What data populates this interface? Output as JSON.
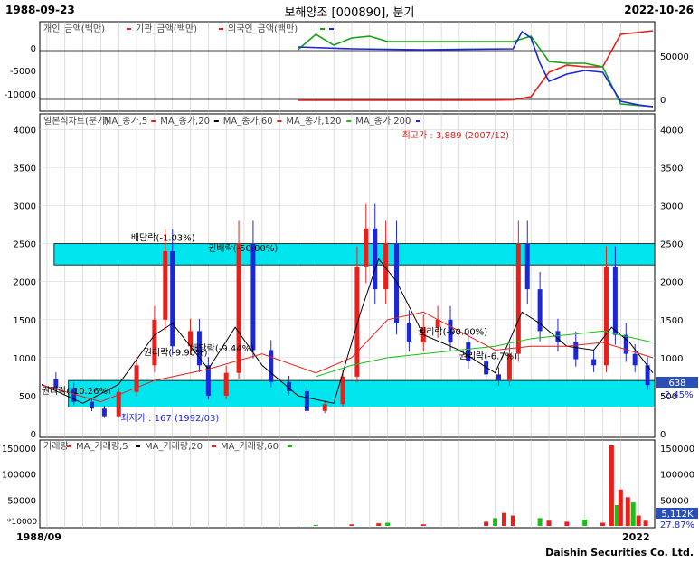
{
  "header": {
    "start_date": "1988-09-23",
    "title": "보해양조 [000890], 분기",
    "end_date": "2022-10-26"
  },
  "footer": {
    "axis_start": "1988/09",
    "axis_end": "2022",
    "credit": "Daishin Securities Co. Ltd."
  },
  "colors": {
    "bull": "#e8201c",
    "bear": "#1c27d8",
    "band": "#00e5ee",
    "ma5": "#e8201c",
    "ma20": "#000000",
    "ma60": "#e8201c",
    "ma120": "#16c016",
    "ma200": "#1c27d8",
    "ma200_legend": "#ff00ff"
  },
  "chart_data": [
    {
      "type": "line",
      "panel": "investor_flow",
      "legend": [
        {
          "label": "개인_금액(백만)",
          "color": "#e8201c"
        },
        {
          "label": "기관_금액(백만)",
          "color": "#e8201c"
        },
        {
          "label": "외국인_금액(백만)",
          "color": "#16a016"
        },
        {
          "label": "",
          "color": "#1c27d8"
        }
      ],
      "left_ticks": [
        "0",
        "-5000",
        "-10000"
      ],
      "right_ticks": [
        "50000",
        "0"
      ],
      "series": [
        {
          "name": "기관_금액(백만)",
          "color": "#e8201c",
          "x": [
            2003,
            2008,
            2012,
            2014,
            2015,
            2016,
            2017,
            2018,
            2019,
            2020,
            2021,
            2022.8
          ],
          "values": [
            -1000,
            -1000,
            -1000,
            -800,
            -500,
            3000,
            30000,
            38000,
            36000,
            36000,
            72000,
            76000
          ]
        },
        {
          "name": "외국인_금액(백만)",
          "color": "#16a016",
          "x": [
            2003,
            2004,
            2005,
            2006,
            2007,
            2008,
            2010,
            2013,
            2015,
            2016,
            2017,
            2018,
            2019,
            2020,
            2021,
            2022.8
          ],
          "values": [
            55000,
            72000,
            60000,
            68000,
            70000,
            64000,
            64000,
            64000,
            64000,
            70000,
            42000,
            40000,
            40000,
            36000,
            -5000,
            -8000
          ]
        },
        {
          "name": "",
          "color": "#1c27d8",
          "x": [
            2003,
            2006,
            2010,
            2015,
            2015.5,
            2016,
            2016.5,
            2017,
            2018,
            2019,
            2020,
            2021,
            2022,
            2022.8
          ],
          "values": [
            58000,
            56000,
            55000,
            56000,
            75000,
            68000,
            40000,
            20000,
            28000,
            32000,
            30000,
            -2000,
            -6000,
            -8000
          ]
        }
      ]
    },
    {
      "type": "candlestick",
      "panel": "price",
      "legend": [
        "일본식차트(분기)",
        "MA_종가,5",
        "MA_종가,20",
        "MA_종가,60",
        "MA_종가,120",
        "MA_종가,200"
      ],
      "y_ticks": [
        0,
        500,
        1000,
        1500,
        2000,
        2500,
        3000,
        3500,
        4000
      ],
      "ylim": [
        0,
        4100
      ],
      "xlim": [
        1988.6,
        2022.9
      ],
      "band_upper": [
        2220,
        2500
      ],
      "band_lower": [
        350,
        700
      ],
      "annotations": [
        {
          "text": "최고가 : 3,889 (2007/12)",
          "x": 2007.9,
          "y": 3889
        },
        {
          "text": "최저가 : 167 (1992/03)",
          "x": 1992.2,
          "y": 167
        },
        {
          "text": "배당락(-1.03%)",
          "x": 1995.2,
          "y": 2540
        },
        {
          "text": "권배락(-50.00%)",
          "x": 1999.5,
          "y": 2400
        },
        {
          "text": "권리락(-10.26%)",
          "x": 1990.2,
          "y": 520
        },
        {
          "text": "권리락(-9.90%)",
          "x": 1995.9,
          "y": 1030
        },
        {
          "text": "배당락(-9.44%)",
          "x": 1998.5,
          "y": 1080
        },
        {
          "text": "권리락(-90.00%)",
          "x": 2011.2,
          "y": 1300
        },
        {
          "text": "권리락(-6.7%)",
          "x": 2013.5,
          "y": 980
        }
      ],
      "last_price": "638",
      "last_change": "-2.45%",
      "close_path": {
        "x": [
          1988.7,
          1989.5,
          1990.5,
          1991.5,
          1992.2,
          1993,
          1994,
          1995,
          1995.6,
          1996,
          1997,
          1997.5,
          1998,
          1999,
          1999.7,
          2000.5,
          2001.5,
          2002.5,
          2003.5,
          2004.5,
          2005.5,
          2006.3,
          2006.8,
          2007.3,
          2007.9,
          2008.5,
          2009.2,
          2010,
          2010.8,
          2011.5,
          2012.5,
          2013.5,
          2014.2,
          2014.8,
          2015.3,
          2015.8,
          2016.5,
          2017.5,
          2018.5,
          2019.5,
          2020.2,
          2020.7,
          2021.3,
          2021.8,
          2022.5
        ],
        "values": [
          720,
          600,
          420,
          330,
          230,
          550,
          900,
          1500,
          2400,
          1150,
          1350,
          900,
          500,
          800,
          2500,
          1100,
          680,
          560,
          300,
          390,
          750,
          2200,
          2700,
          1900,
          2500,
          1450,
          1200,
          1400,
          1500,
          1200,
          950,
          780,
          700,
          1050,
          2500,
          1900,
          1350,
          1200,
          980,
          900,
          2200,
          1300,
          1050,
          900,
          640
        ]
      },
      "ma_lines": [
        {
          "name": "MA_종가,20",
          "color": "#000000",
          "x": [
            1988.7,
            1991,
            1993,
            1995,
            1996,
            1998,
            1999.5,
            2001,
            2003,
            2005,
            2006.5,
            2007.5,
            2008.5,
            2010,
            2012,
            2014,
            2015.5,
            2016.5,
            2018,
            2019.5,
            2020.5,
            2021.5,
            2022.8
          ],
          "values": [
            650,
            400,
            650,
            1300,
            1450,
            850,
            1400,
            900,
            500,
            400,
            1600,
            2300,
            2000,
            1300,
            1100,
            800,
            1600,
            1450,
            1150,
            1100,
            1400,
            1200,
            800
          ]
        },
        {
          "name": "MA_종가,60",
          "color": "#e8201c",
          "x": [
            1988.7,
            1992,
            1995,
            1998,
            2001,
            2004,
            2006,
            2008,
            2010,
            2012,
            2014,
            2016,
            2018,
            2020,
            2022.8
          ],
          "values": [
            640,
            420,
            700,
            850,
            1050,
            800,
            1000,
            1500,
            1600,
            1350,
            1100,
            1150,
            1150,
            1200,
            1000
          ]
        },
        {
          "name": "MA_종가,120",
          "color": "#16c016",
          "x": [
            2004,
            2006,
            2008,
            2010,
            2012,
            2014,
            2016,
            2018,
            2020,
            2022.8
          ],
          "values": [
            750,
            900,
            1000,
            1050,
            1100,
            1150,
            1250,
            1300,
            1350,
            1200
          ]
        }
      ]
    },
    {
      "type": "bar",
      "panel": "volume",
      "legend": [
        "거래량",
        "MA_거래량,5",
        "MA_거래량,20",
        "MA_거래량,60"
      ],
      "unit": "*10000",
      "left_ticks": [
        0,
        50000,
        100000,
        150000
      ],
      "right_ticks": [
        50000,
        100000,
        150000
      ],
      "ylim": [
        0,
        160000
      ],
      "last_value": "5,112K",
      "last_change": "27.87%",
      "x": [
        2004,
        2006,
        2007.5,
        2008,
        2010,
        2013.5,
        2014,
        2014.5,
        2015,
        2016.5,
        2017,
        2018,
        2019,
        2020,
        2020.5,
        2020.8,
        2021,
        2021.4,
        2021.7,
        2022,
        2022.4
      ],
      "values": [
        2000,
        3000,
        5000,
        6000,
        3000,
        8000,
        15000,
        25000,
        20000,
        15000,
        10000,
        8000,
        12000,
        6000,
        155000,
        40000,
        70000,
        55000,
        45000,
        20000,
        10000
      ]
    }
  ]
}
